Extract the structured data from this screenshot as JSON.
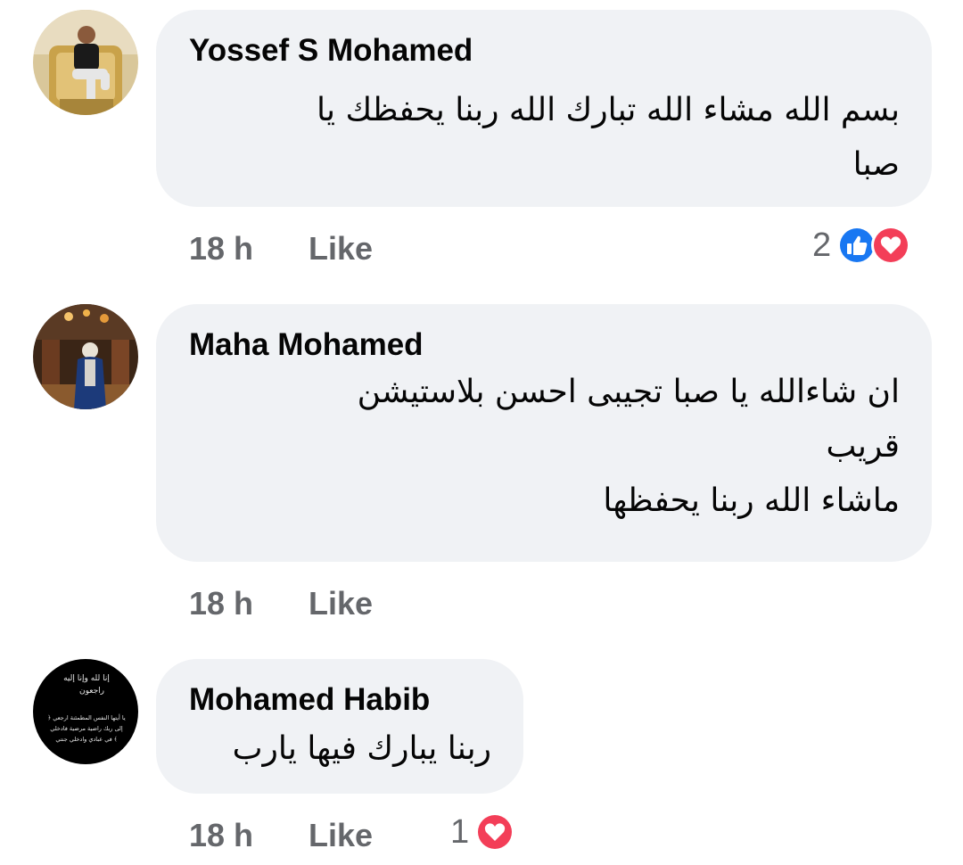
{
  "comments": [
    {
      "author": "Yossef S Mohamed",
      "text": "بسم الله مشاء الله تبارك الله ربنا يحفظك يا\nصبا",
      "time": "18 h",
      "like_label": "Like",
      "reaction_count": "2",
      "reactions": [
        "like-icon",
        "love-icon"
      ]
    },
    {
      "author": "Maha Mohamed",
      "text": "ان شاءالله يا صبا تجيبى احسن بلاستيشن\nقريب\nماشاء الله ربنا يحفظها",
      "time": "18 h",
      "like_label": "Like"
    },
    {
      "author": "Mohamed Habib",
      "text": "ربنا يبارك فيها يارب",
      "time": "18 h",
      "like_label": "Like",
      "reaction_count": "1",
      "reactions": [
        "love-icon"
      ]
    }
  ],
  "avatar_3_text": {
    "line1": "إنا لله وإنا إليه",
    "line2": "راجعون",
    "line3": "﴿ يا أيتها النفس المطمئنة ارجعي",
    "line4": "إلى ربك راضية مرضية فادخلي",
    "line5": "في عبادي وادخلي جنتي ﴾"
  },
  "colors": {
    "bubble": "#f0f2f5",
    "meta_text": "#65676b",
    "like_blue": "#1877f2",
    "love_red": "#f33e58"
  }
}
